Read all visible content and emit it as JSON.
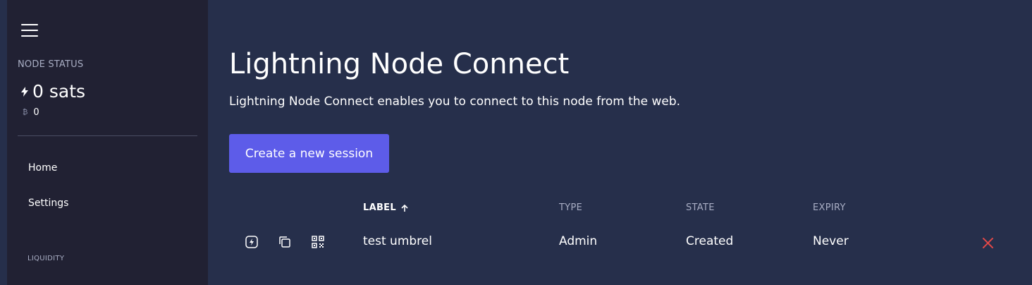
{
  "sidebar": {
    "node_status_label": "NODE STATUS",
    "sats_balance": "0 sats",
    "btc_balance": "0",
    "nav": [
      {
        "label": "Home"
      },
      {
        "label": "Settings"
      }
    ],
    "section_liquidity": "LIQUIDITY"
  },
  "main": {
    "title": "Lightning Node Connect",
    "subtitle": "Lightning Node Connect enables you to connect to this node from the web.",
    "create_button_label": "Create a new session"
  },
  "table": {
    "columns": [
      "LABEL",
      "TYPE",
      "STATE",
      "EXPIRY"
    ],
    "sort_column": "LABEL",
    "sort_direction": "ascending",
    "rows": [
      {
        "label": "test umbrel",
        "type": "Admin",
        "state": "Created",
        "expiry": "Never"
      }
    ]
  },
  "icons": {
    "menu": "hamburger-menu-icon",
    "bolt": "lightning-bolt-icon",
    "btc": "bitcoin-icon",
    "connect": "lightning-connect-icon",
    "copy": "copy-icon",
    "qr": "qr-code-icon",
    "delete": "close-icon",
    "sort": "arrow-up-icon"
  },
  "colors": {
    "background": "#262f4b",
    "sidebar": "#212133",
    "accent": "#5d5ce9",
    "danger": "#e04848",
    "muted": "#a9aec4"
  }
}
